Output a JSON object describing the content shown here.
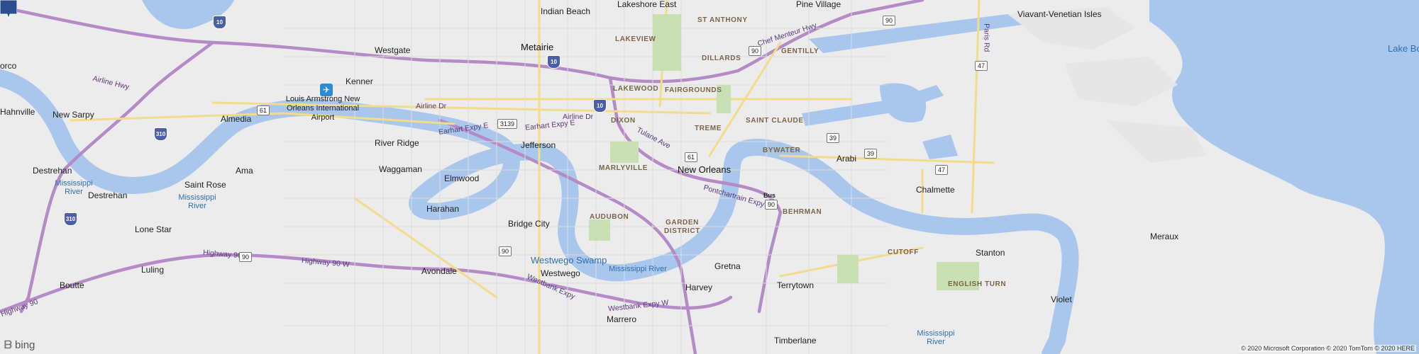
{
  "map": {
    "center_label": "New Orleans",
    "colors": {
      "land": "#ececec",
      "water": "#a9c7ec",
      "highway": "#b48ac7",
      "major_road": "#f2dc8a",
      "marker": "#2b4e8c"
    }
  },
  "cities": [
    {
      "id": "indian-beach",
      "label": "Indian Beach"
    },
    {
      "id": "lakeshore-east",
      "label": "Lakeshore East"
    },
    {
      "id": "pine-village",
      "label": "Pine Village"
    },
    {
      "id": "viavant-venetian-isles",
      "label": "Viavant-Venetian Isles"
    },
    {
      "id": "westgate",
      "label": "Westgate"
    },
    {
      "id": "metairie",
      "label": "Metairie"
    },
    {
      "id": "kenner",
      "label": "Kenner"
    },
    {
      "id": "hahnville",
      "label": "Hahnville"
    },
    {
      "id": "new-sarpy",
      "label": "New Sarpy"
    },
    {
      "id": "almedia",
      "label": "Almedia"
    },
    {
      "id": "airport",
      "label": "Louis Armstrong New Orleans International Airport"
    },
    {
      "id": "river-ridge",
      "label": "River Ridge"
    },
    {
      "id": "jefferson",
      "label": "Jefferson"
    },
    {
      "id": "new-orleans",
      "label": "New Orleans"
    },
    {
      "id": "arabi",
      "label": "Arabi"
    },
    {
      "id": "chalmette",
      "label": "Chalmette"
    },
    {
      "id": "destrehan-1",
      "label": "Destrehan"
    },
    {
      "id": "destrehan-2",
      "label": "Destrehan"
    },
    {
      "id": "ama",
      "label": "Ama"
    },
    {
      "id": "waggaman",
      "label": "Waggaman"
    },
    {
      "id": "saint-rose",
      "label": "Saint Rose"
    },
    {
      "id": "elmwood",
      "label": "Elmwood"
    },
    {
      "id": "harahan",
      "label": "Harahan"
    },
    {
      "id": "bridge-city",
      "label": "Bridge City"
    },
    {
      "id": "lone-star",
      "label": "Lone Star"
    },
    {
      "id": "luling",
      "label": "Luling"
    },
    {
      "id": "boutte",
      "label": "Boutte"
    },
    {
      "id": "avondale",
      "label": "Avondale"
    },
    {
      "id": "westwego",
      "label": "Westwego"
    },
    {
      "id": "gretna",
      "label": "Gretna"
    },
    {
      "id": "harvey",
      "label": "Harvey"
    },
    {
      "id": "terrytown",
      "label": "Terrytown"
    },
    {
      "id": "marrero",
      "label": "Marrero"
    },
    {
      "id": "timberlane",
      "label": "Timberlane"
    },
    {
      "id": "stanton",
      "label": "Stanton"
    },
    {
      "id": "meraux",
      "label": "Meraux"
    },
    {
      "id": "violet",
      "label": "Violet"
    },
    {
      "id": "orco",
      "label": "orco"
    }
  ],
  "neighborhoods": [
    "ST ANTHONY",
    "LAKEVIEW",
    "GENTILLY",
    "DILLARDS",
    "FAIRGROUNDS",
    "LAKEWOOD",
    "DIXON",
    "SAINT CLAUDE",
    "TREME",
    "BYWATER",
    "MARLYVILLE",
    "AUDUBON",
    "GARDEN",
    "DISTRICT",
    "BEHRMAN",
    "CUTOFF",
    "ENGLISH TURN"
  ],
  "water_labels": {
    "lake_borgne": "Lake Borg",
    "miss_river_1": "Mississippi River",
    "miss_river_2": "Mississippi River",
    "miss_river_3": "Mississippi River",
    "miss_river_4": "Mississippi River",
    "westwego_swamp": "Westwego Swamp"
  },
  "roads": {
    "airline_hwy": "Airline Hwy",
    "airline_dr_1": "Airline Dr",
    "airline_dr_2": "Airline Dr",
    "earhart_expy_1": "Earhart Expy E",
    "earhart_expy_2": "Earhart Expy E",
    "tulane_ave": "Tulane Ave",
    "chef_menteur_hwy": "Chef Menteur Hwy",
    "paris_rd": "Paris Rd",
    "pontchartrain_expy": "Pontchartrain Expy",
    "highway_90_1": "Highway 90",
    "highway_90_2": "Highway 90 W",
    "westbank_expy_1": "Westbank Expy",
    "westbank_expy_2": "Westbank Expy W",
    "hwy_90_lower": "Highway 90"
  },
  "shields": {
    "i10_a": "10",
    "i10_b": "10",
    "i10_c": "10",
    "i310_a": "310",
    "i310_b": "310",
    "us90_a": "90",
    "us90_b": "90",
    "us90_c": "90",
    "us90_d": "90",
    "us90_e": "90",
    "la61_a": "61",
    "la61_b": "61",
    "la47_a": "47",
    "la47_b": "47",
    "la39_a": "39",
    "la39_b": "39",
    "la3139": "3139",
    "bus90": "Bus"
  },
  "branding": {
    "logo": "bing",
    "copyright": "© 2020 Microsoft Corporation © 2020 TomTom © 2020 HERE"
  }
}
